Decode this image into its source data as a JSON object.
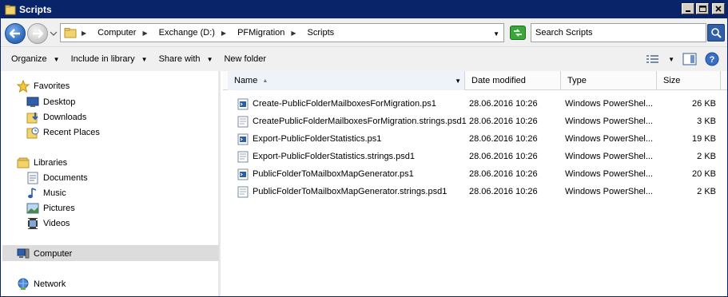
{
  "window": {
    "title": "Scripts"
  },
  "address": {
    "crumbs": [
      "Computer",
      "Exchange (D:)",
      "PFMigration",
      "Scripts"
    ]
  },
  "search": {
    "placeholder": "Search Scripts"
  },
  "toolbar": {
    "organize": "Organize",
    "include_in_library": "Include in library",
    "share_with": "Share with",
    "new_folder": "New folder"
  },
  "nav": {
    "favorites": "Favorites",
    "desktop": "Desktop",
    "downloads": "Downloads",
    "recent_places": "Recent Places",
    "libraries": "Libraries",
    "documents": "Documents",
    "music": "Music",
    "pictures": "Pictures",
    "videos": "Videos",
    "computer": "Computer",
    "network": "Network"
  },
  "columns": {
    "name": "Name",
    "date_modified": "Date modified",
    "type": "Type",
    "size": "Size"
  },
  "files": [
    {
      "name": "Create-PublicFolderMailboxesForMigration.ps1",
      "date": "28.06.2016 10:26",
      "type": "Windows PowerShel...",
      "size": "26 KB",
      "icon": "powershell-script-icon"
    },
    {
      "name": "CreatePublicFolderMailboxesForMigration.strings.psd1",
      "date": "28.06.2016 10:26",
      "type": "Windows PowerShel...",
      "size": "3 KB",
      "icon": "powershell-data-icon"
    },
    {
      "name": "Export-PublicFolderStatistics.ps1",
      "date": "28.06.2016 10:26",
      "type": "Windows PowerShel...",
      "size": "19 KB",
      "icon": "powershell-script-icon"
    },
    {
      "name": "Export-PublicFolderStatistics.strings.psd1",
      "date": "28.06.2016 10:26",
      "type": "Windows PowerShel...",
      "size": "2 KB",
      "icon": "powershell-data-icon"
    },
    {
      "name": "PublicFolderToMailboxMapGenerator.ps1",
      "date": "28.06.2016 10:26",
      "type": "Windows PowerShel...",
      "size": "20 KB",
      "icon": "powershell-script-icon"
    },
    {
      "name": "PublicFolderToMailboxMapGenerator.strings.psd1",
      "date": "28.06.2016 10:26",
      "type": "Windows PowerShel...",
      "size": "2 KB",
      "icon": "powershell-data-icon"
    }
  ],
  "colors": {
    "titlebar": "#0a246a",
    "selection": "#dcdcdc"
  }
}
